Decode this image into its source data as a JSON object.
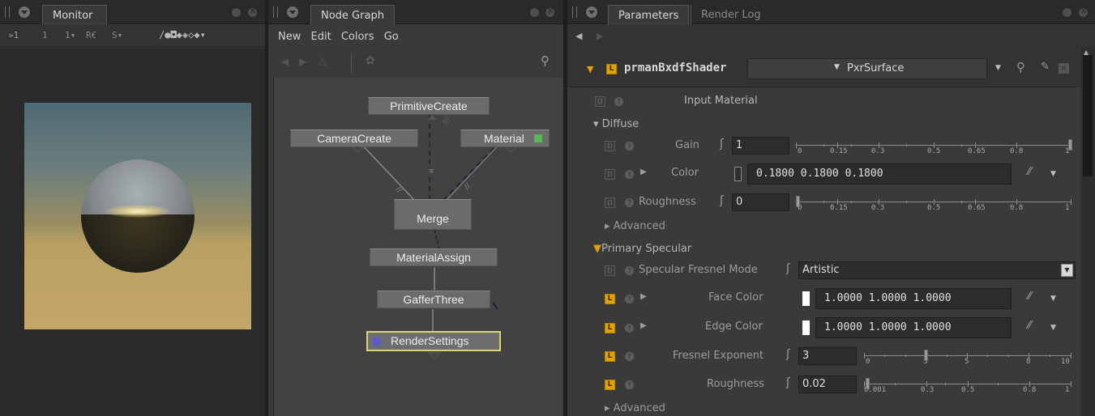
{
  "monitor": {
    "tab": "Monitor",
    "toolbar": [
      "»1",
      "1",
      "1▾",
      "R€",
      "S▾",
      "/●◘◆◈◇◆▾"
    ]
  },
  "node_graph": {
    "tab": "Node Graph",
    "menu": [
      "New",
      "Edit",
      "Colors",
      "Go"
    ],
    "nodes": {
      "primitive_create": "PrimitiveCreate",
      "camera_create": "CameraCreate",
      "material": "Material",
      "merge": "Merge",
      "material_assign": "MaterialAssign",
      "gaffer_three": "GafferThree",
      "render_settings": "RenderSettings"
    },
    "colors": {
      "material_indicator": "#58b858",
      "render_settings_indicator": "#5a5ad0",
      "selected_border": "#d8d27a"
    }
  },
  "parameters": {
    "tabs": [
      "Parameters",
      "Render Log"
    ],
    "header": {
      "name": "prmanBxdfShader",
      "shader": "PxrSurface"
    },
    "input_material": "Input Material",
    "diffuse": {
      "section": "Diffuse",
      "gain_label": "Gain",
      "gain_value": "1",
      "color_label": "Color",
      "color_value": "0.1800  0.1800  0.1800",
      "roughness_label": "Roughness",
      "roughness_value": "0",
      "advanced": "Advanced",
      "slider_ticks": [
        "0",
        "0.15",
        "0.3",
        "0.5",
        "0.65",
        "0.8",
        "1"
      ]
    },
    "primary_specular": {
      "section": "Primary Specular",
      "fresnel_mode_label": "Specular Fresnel Mode",
      "fresnel_mode_value": "Artistic",
      "face_color_label": "Face Color",
      "face_color_value": "1.0000  1.0000  1.0000",
      "edge_color_label": "Edge Color",
      "edge_color_value": "1.0000  1.0000  1.0000",
      "fresnel_exponent_label": "Fresnel Exponent",
      "fresnel_exponent_value": "3",
      "fresnel_ticks": [
        "0",
        "3",
        "5",
        "8",
        "10"
      ],
      "roughness_label": "Roughness",
      "roughness_value": "0.02",
      "roughness_ticks": [
        "0.001",
        "0.3",
        "0.5",
        "0.8",
        "1"
      ],
      "advanced": "Advanced"
    },
    "colors": {
      "accent": "#e0a400",
      "diffuse_swatch": "#2e2e2e",
      "specular_swatch": "#ffffff"
    }
  }
}
